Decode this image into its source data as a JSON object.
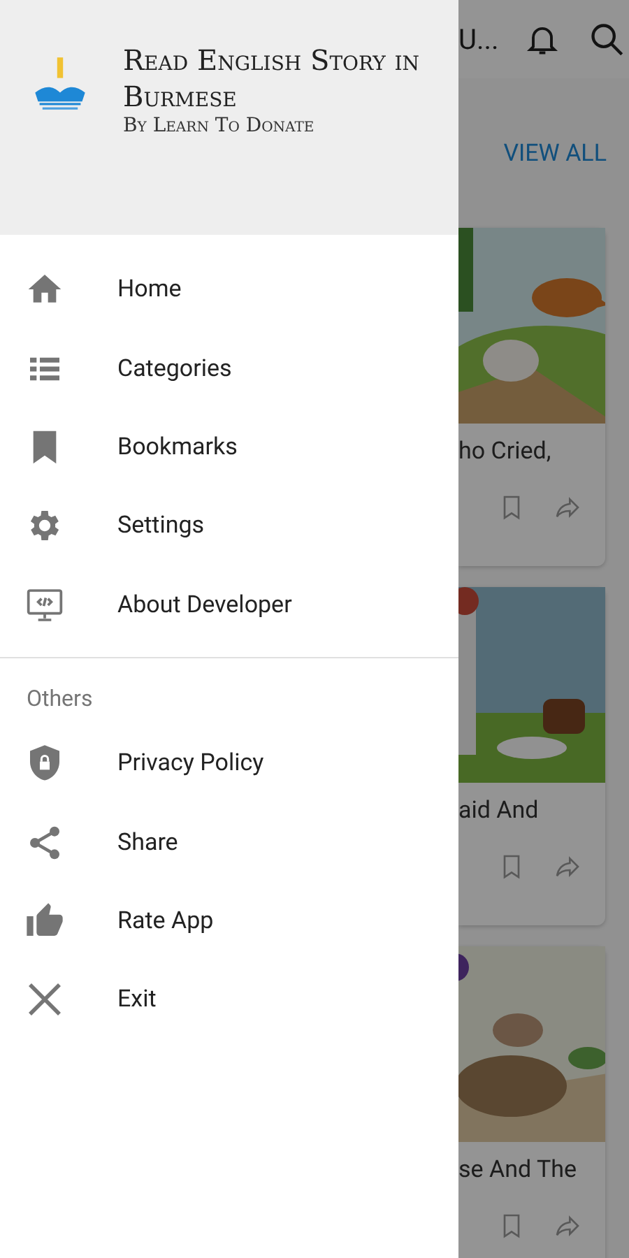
{
  "drawer": {
    "header": {
      "title": "Read English Story in Burmese",
      "subtitle": "By Learn To Donate"
    },
    "items": [
      {
        "label": "Home"
      },
      {
        "label": "Categories"
      },
      {
        "label": "Bookmarks"
      },
      {
        "label": "Settings"
      },
      {
        "label": "About Developer"
      }
    ],
    "section_title": "Others",
    "other_items": [
      {
        "label": "Privacy Policy"
      },
      {
        "label": "Share"
      },
      {
        "label": "Rate App"
      },
      {
        "label": "Exit"
      }
    ]
  },
  "background": {
    "toolbar_title": "U...",
    "link": "VIEW ALL",
    "cards": [
      {
        "title": "ho Cried,"
      },
      {
        "title": "aid And"
      },
      {
        "title": "se And The"
      }
    ]
  }
}
